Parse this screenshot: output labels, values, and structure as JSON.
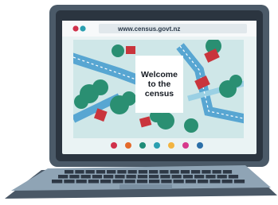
{
  "browser": {
    "url": "www.census.govt.nz"
  },
  "card": {
    "lines": [
      "Welcome",
      "to the",
      "census"
    ]
  },
  "dots": [
    {
      "color": "#d0314a"
    },
    {
      "color": "#e46a2b"
    },
    {
      "color": "#1d8c78"
    },
    {
      "color": "#2a9fb0"
    },
    {
      "color": "#f2b441"
    },
    {
      "color": "#d7398c"
    },
    {
      "color": "#2b6fa8"
    }
  ],
  "colors": {
    "laptop_body": "#4a5866",
    "screen_bezel": "#2b3540",
    "keyboard_deck": "#8fa4b5",
    "keys": "#2e3845",
    "map_land": "#cfe7e8",
    "road": "#58a6d2",
    "house": "#c9353c",
    "trees": "#2a8f72"
  }
}
